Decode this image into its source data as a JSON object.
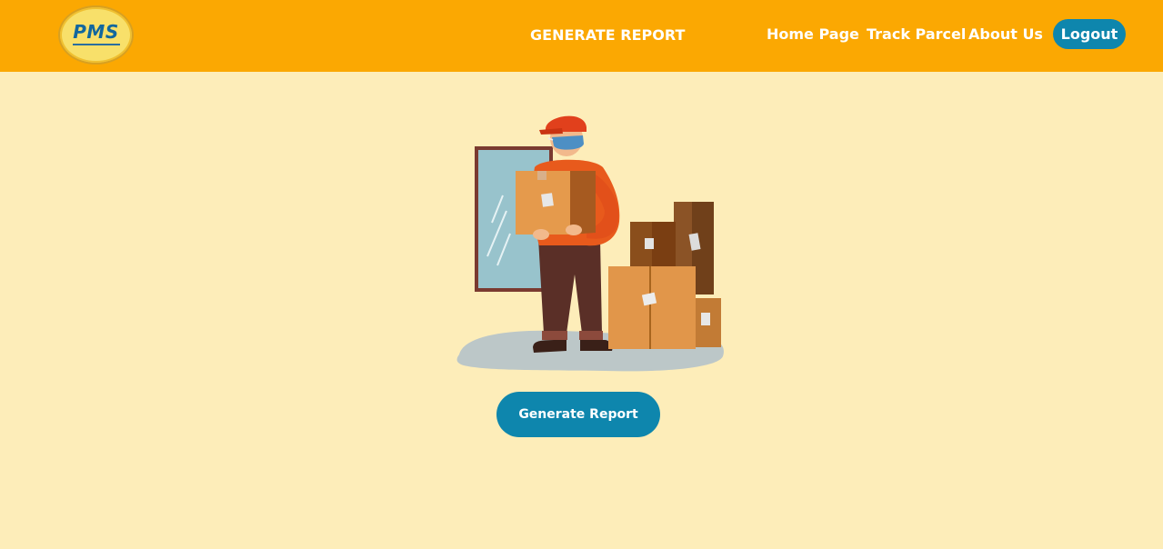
{
  "header": {
    "logo_text": "PMS",
    "page_title": "GENERATE REPORT",
    "nav": {
      "home": "Home Page",
      "track": "Track Parcel",
      "about": "About Us"
    },
    "logout_label": "Logout"
  },
  "main": {
    "illustration_icon": "delivery-person-icon",
    "generate_button_label": "Generate Report"
  },
  "colors": {
    "header_bg": "#fba802",
    "page_bg": "#fdedb9",
    "button_bg": "#0e86ad"
  }
}
